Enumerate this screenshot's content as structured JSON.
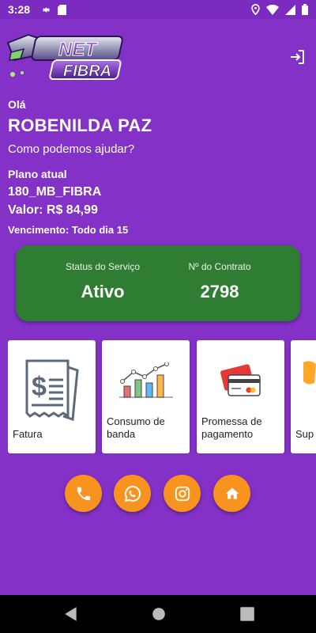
{
  "status_bar": {
    "time": "3:28",
    "left_icons": [
      "gear-icon",
      "sd-card-icon"
    ],
    "right_icons": [
      "location-icon",
      "wifi-icon",
      "signal-icon",
      "battery-icon"
    ]
  },
  "header": {
    "logo_text_top": "NET",
    "logo_text_bottom": "FIBRA",
    "logout_icon": "logout-icon"
  },
  "greeting": {
    "hello": "Olá",
    "user_name": "ROBENILDA PAZ",
    "help": "Como podemos ajudar?"
  },
  "plan": {
    "label": "Plano atual",
    "name": "180_MB_FIBRA",
    "value": "Valor: R$ 84,99",
    "due": "Vencimento: Todo dia 15"
  },
  "status_card": {
    "service_label": "Status do Serviço",
    "service_value": "Ativo",
    "contract_label": "Nº do Contrato",
    "contract_value": "2798",
    "color": "#2E7D32"
  },
  "menu": [
    {
      "label": "Fatura",
      "icon": "invoice-icon"
    },
    {
      "label": "Consumo de banda",
      "icon": "bandwidth-chart-icon"
    },
    {
      "label": "Promessa de pagamento",
      "icon": "credit-card-icon"
    },
    {
      "label": "Sup",
      "icon": "support-icon"
    }
  ],
  "social": [
    {
      "name": "phone",
      "icon": "phone-icon"
    },
    {
      "name": "whatsapp",
      "icon": "whatsapp-icon"
    },
    {
      "name": "instagram",
      "icon": "instagram-icon"
    },
    {
      "name": "home",
      "icon": "home-icon"
    }
  ],
  "colors": {
    "background": "#8331C7",
    "accent": "#F7931E",
    "status_green": "#2E7D32"
  }
}
